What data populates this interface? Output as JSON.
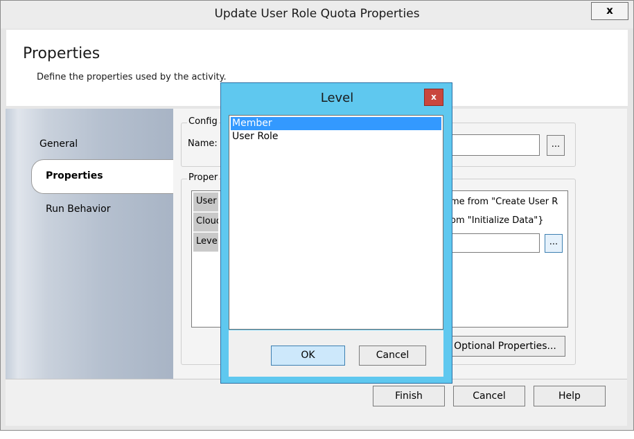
{
  "window": {
    "title": "Update User Role Quota Properties",
    "close_glyph": "x"
  },
  "header": {
    "title": "Properties",
    "description": "Define the properties used by the activity."
  },
  "nav": {
    "items": [
      {
        "label": "General"
      },
      {
        "label": "Properties"
      },
      {
        "label": "Run Behavior"
      }
    ]
  },
  "content": {
    "config_group_label": "Config",
    "name_label": "Name:",
    "ellipsis_label": "...",
    "properties_group_label": "Proper",
    "rows": [
      {
        "label": "User",
        "value": "me from \"Create User R"
      },
      {
        "label": "Cloud",
        "value": "om \"Initialize Data\"}"
      },
      {
        "label": "Level",
        "value": ""
      }
    ],
    "optional_properties_button": "Optional Properties..."
  },
  "footer": {
    "finish": "Finish",
    "cancel": "Cancel",
    "help": "Help"
  },
  "modal": {
    "title": "Level",
    "close_glyph": "x",
    "options": [
      {
        "label": "Member",
        "selected": true
      },
      {
        "label": "User Role",
        "selected": false
      }
    ],
    "ok": "OK",
    "cancel": "Cancel"
  },
  "colors": {
    "modal_frame": "#5fc8ef",
    "selection": "#3399ff",
    "modal_close": "#c9463d"
  }
}
